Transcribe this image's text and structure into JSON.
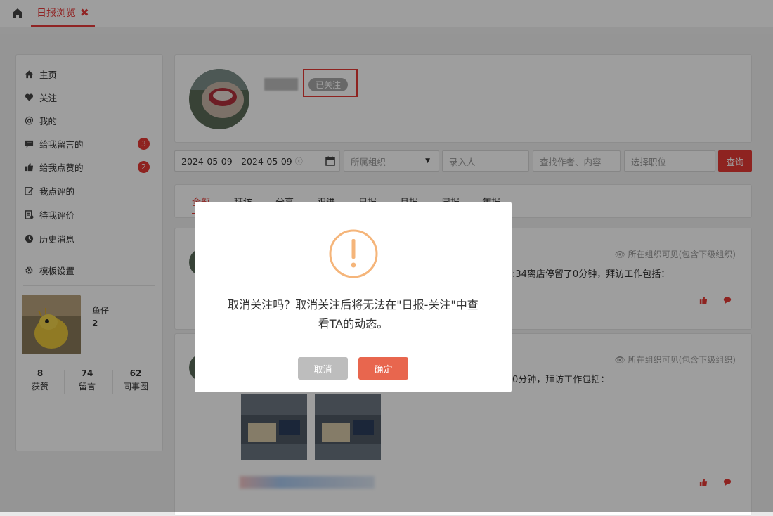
{
  "topbar": {
    "tab_label": "日报浏览",
    "tab_close": "✖"
  },
  "sidebar": {
    "items": [
      {
        "label": "主页"
      },
      {
        "label": "关注"
      },
      {
        "label": "我的"
      },
      {
        "label": "给我留言的",
        "badge": "3"
      },
      {
        "label": "给我点赞的",
        "badge": "2"
      },
      {
        "label": "我点评的"
      },
      {
        "label": "待我评价"
      },
      {
        "label": "历史消息"
      },
      {
        "label": "模板设置"
      }
    ],
    "user": {
      "name": "鱼仔",
      "number": "2"
    },
    "stats": [
      {
        "value": "8",
        "label": "获赞"
      },
      {
        "value": "74",
        "label": "留言"
      },
      {
        "value": "62",
        "label": "同事圈"
      }
    ]
  },
  "profile": {
    "follow_status": "已关注"
  },
  "filters": {
    "date_range": "2024-05-09 - 2024-05-09",
    "org_placeholder": "所属组织",
    "recorder_placeholder": "录入人",
    "search_placeholder": "查找作者、内容",
    "position_placeholder": "选择职位",
    "query_label": "查询"
  },
  "type_tabs": [
    "全部",
    "拜访",
    "分享",
    "跟进",
    "日报",
    "月报",
    "周报",
    "年报"
  ],
  "posts": [
    {
      "visibility": "所在组织可见(包含下级组织)",
      "text": ":34离店停留了0分钟，拜访工作包括："
    },
    {
      "visibility": "所在组织可见(包含下级组织)",
      "text": "0分钟，拜访工作包括："
    }
  ],
  "dialog": {
    "message_line1": "取消关注吗？取消关注后将无法在\"日报-关注\"中查",
    "message_line2": "看TA的动态。",
    "cancel_label": "取消",
    "confirm_label": "确定",
    "icon": "exclamation-circle-icon"
  },
  "colors": {
    "accent": "#e53935",
    "confirm": "#e8664e",
    "warning": "#f5b57a"
  }
}
